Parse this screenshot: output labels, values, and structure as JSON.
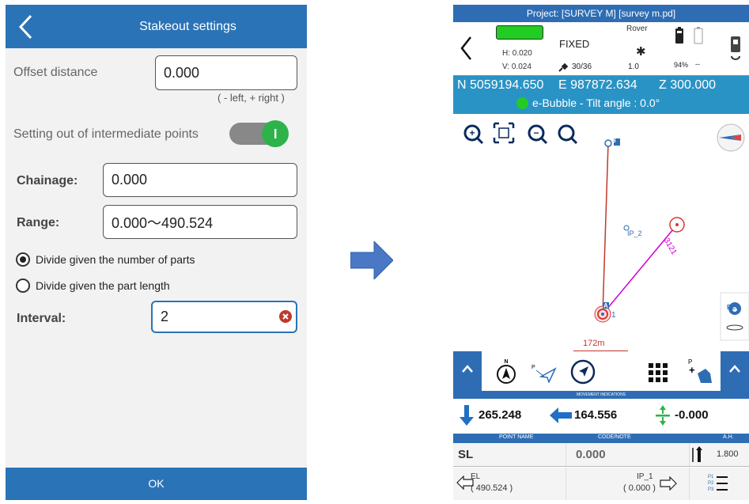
{
  "left": {
    "title": "Stakeout settings",
    "offset_label": "Offset distance",
    "offset_value": "0.000",
    "offset_hint": "( - left, + right )",
    "intermediate_label": "Setting out of intermediate points",
    "chainage_label": "Chainage:",
    "chainage_value": "0.000",
    "range_label": "Range:",
    "range_value": "0.000〜490.524",
    "radio1": "Divide given the number of parts",
    "radio2": "Divide given the part length",
    "interval_label": "Interval:",
    "interval_value": "2",
    "ok": "OK"
  },
  "right": {
    "project": "Project: [SURVEY M] [survey m.pd]",
    "h": "H: 0.020",
    "v": "V: 0.024",
    "fix": "FIXED",
    "sats": "30/36",
    "rover": "Rover",
    "age": "1.0",
    "battery": "94%",
    "dash": "--",
    "north": "N 5059194.650",
    "east": "E 987872.634",
    "z": "Z 300.000",
    "bubble": "e-Bubble - Tilt angle : 0.0°",
    "scale": "172m",
    "pt_b": "B",
    "pt_ip2": "IP_2",
    "pt_a": "A",
    "pt_1": "1",
    "pt_mag": "3121",
    "movement": "MOVEMENT INDICATIONS",
    "m1": "265.248",
    "m2": "164.556",
    "m3": "-0.000",
    "col1": "POINT NAME",
    "col2": "CODE/NOTE",
    "col3": "A.H.",
    "pname": "SL",
    "code": "0.000",
    "ah": "1.800",
    "prev_label": "EL",
    "prev_value": "( 490.524 )",
    "next_label": "IP_1",
    "next_value": "( 0.000 )",
    "rec": "REC",
    "p1": "P1",
    "p2": "P2",
    "p3": "P3"
  },
  "colors": {
    "header_blue": "#2b73b7",
    "coord_blue": "#2a93c5",
    "toggle_green": "#2db34a",
    "gps_green": "#22cc22"
  }
}
